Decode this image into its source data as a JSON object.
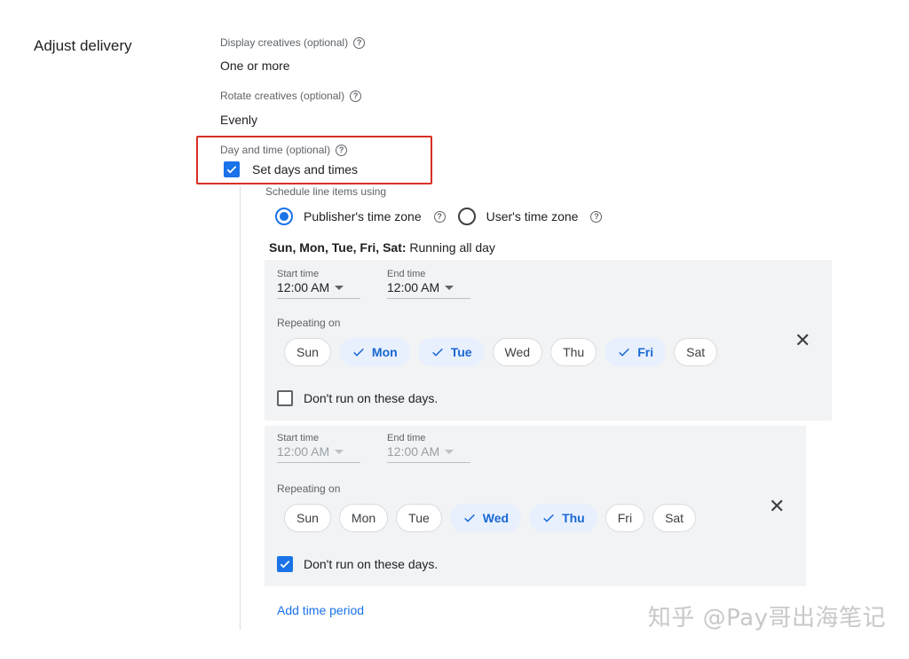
{
  "section": {
    "title": "Adjust delivery"
  },
  "display_creatives": {
    "label": "Display creatives (optional)",
    "value": "One or more"
  },
  "rotate_creatives": {
    "label": "Rotate creatives (optional)",
    "value": "Evenly"
  },
  "day_time": {
    "label": "Day and time (optional)",
    "checkbox_label": "Set days and times"
  },
  "schedule": {
    "label": "Schedule line items using",
    "publisher_tz": "Publisher's time zone",
    "user_tz": "User's time zone",
    "summary_bold": "Sun, Mon, Tue, Fri, Sat:",
    "summary_rest": " Running all day"
  },
  "periods": [
    {
      "start_label": "Start time",
      "start_value": "12:00 AM",
      "end_label": "End time",
      "end_value": "12:00 AM",
      "repeating_label": "Repeating on",
      "days": [
        "Sun",
        "Mon",
        "Tue",
        "Wed",
        "Thu",
        "Fri",
        "Sat"
      ],
      "dont_run_label": "Don't run on these days."
    },
    {
      "start_label": "Start time",
      "start_value": "12:00 AM",
      "end_label": "End time",
      "end_value": "12:00 AM",
      "repeating_label": "Repeating on",
      "days": [
        "Sun",
        "Mon",
        "Tue",
        "Wed",
        "Thu",
        "Fri",
        "Sat"
      ],
      "dont_run_label": "Don't run on these days."
    }
  ],
  "add_period": "Add time period",
  "watermark": "知乎 @Pay哥出海笔记",
  "colors": {
    "accent": "#1a73e8",
    "highlight": "#d93025",
    "panel": "#f1f3f4",
    "chip_selected": "#e8f0fe"
  }
}
